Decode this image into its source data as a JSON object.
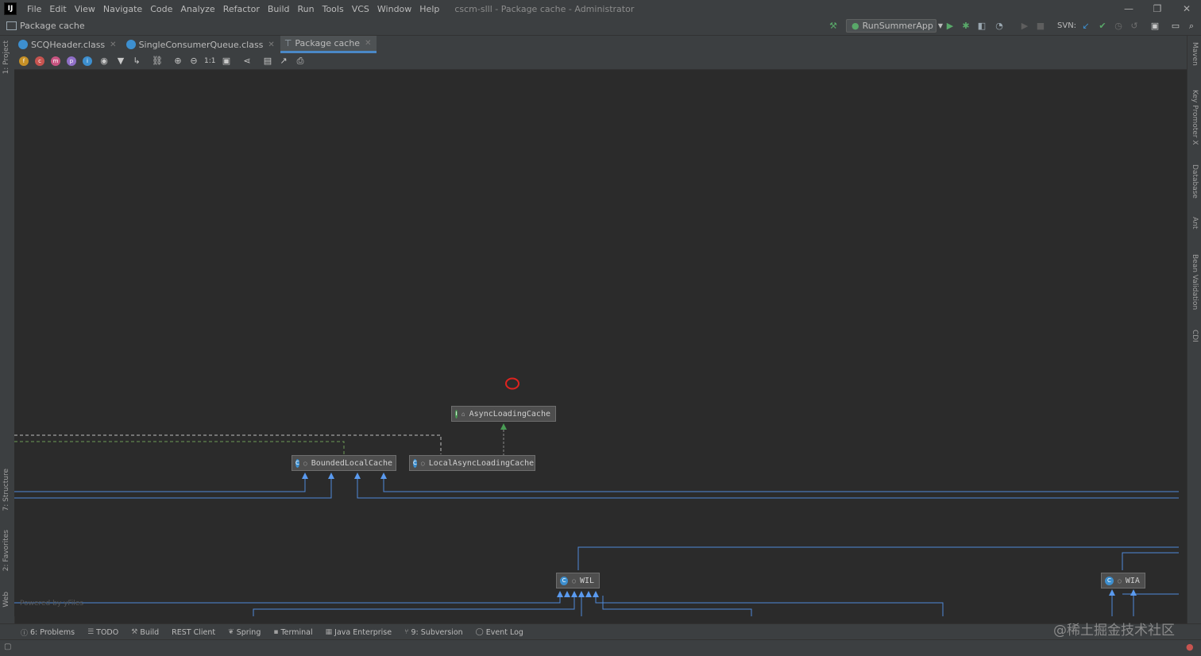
{
  "window": {
    "logo": "IJ",
    "title": "cscm-slll - Package cache - Administrator",
    "menu": [
      "File",
      "Edit",
      "View",
      "Navigate",
      "Code",
      "Analyze",
      "Refactor",
      "Build",
      "Run",
      "Tools",
      "VCS",
      "Window",
      "Help"
    ],
    "controls": {
      "minimize": "—",
      "restore": "❐",
      "close": "✕"
    }
  },
  "navbar": {
    "breadcrumb": "Package cache",
    "run_config": "RunSummerApp",
    "svn_label": "SVN:"
  },
  "left_stripe": {
    "project": "1: Project",
    "structure": "7: Structure",
    "favorites": "2: Favorites",
    "web": "Web"
  },
  "right_stripe": {
    "maven": "Maven",
    "key_promoter": "Key Promoter X",
    "database": "Database",
    "ant": "Ant",
    "bean_validation": "Bean Validation",
    "cdi": "CDI"
  },
  "editor_tabs": [
    {
      "label": "SCQHeader.class",
      "active": false
    },
    {
      "label": "SingleConsumerQueue.class",
      "active": false
    },
    {
      "label": "Package cache",
      "active": true
    }
  ],
  "diagram_toolbar": {
    "filters": [
      "f",
      "c",
      "m",
      "p",
      "i"
    ],
    "zoom_actual": "1:1"
  },
  "diagram": {
    "nodes": [
      {
        "id": "AsyncLoadingCache",
        "label": "AsyncLoadingCache",
        "kind": "interface",
        "icon_color": "#499c54",
        "icon_letter": "I"
      },
      {
        "id": "BoundedLocalCache",
        "label": "BoundedLocalCache",
        "kind": "class",
        "icon_color": "#3d8fcf",
        "icon_letter": "C"
      },
      {
        "id": "LocalAsyncLoadingCache",
        "label": "LocalAsyncLoadingCache",
        "kind": "class",
        "icon_color": "#3d8fcf",
        "icon_letter": "C"
      },
      {
        "id": "WIL",
        "label": "WIL",
        "kind": "class",
        "icon_color": "#3d8fcf",
        "icon_letter": "C"
      },
      {
        "id": "WIA",
        "label": "WIA",
        "kind": "class",
        "icon_color": "#3d8fcf",
        "icon_letter": "C"
      }
    ],
    "powered_by": "Powered by yFiles"
  },
  "bottom_tabs": [
    {
      "label": "6: Problems",
      "icon": "info-icon"
    },
    {
      "label": "TODO",
      "icon": "list-icon"
    },
    {
      "label": "Build",
      "icon": "hammer-icon"
    },
    {
      "label": "REST Client",
      "icon": ""
    },
    {
      "label": "Spring",
      "icon": "spring-icon"
    },
    {
      "label": "Terminal",
      "icon": "terminal-icon"
    },
    {
      "label": "Java Enterprise",
      "icon": "java-ee-icon"
    },
    {
      "label": "9: Subversion",
      "icon": "svn-icon"
    },
    {
      "label": "Event Log",
      "icon": "event-log-icon"
    }
  ],
  "watermark": "@稀土掘金技术社区",
  "colors": {
    "accent": "#4a88c7",
    "edge_blue": "#4f8ad8",
    "edge_green": "#499c54",
    "annotation_red": "#e0231f"
  }
}
